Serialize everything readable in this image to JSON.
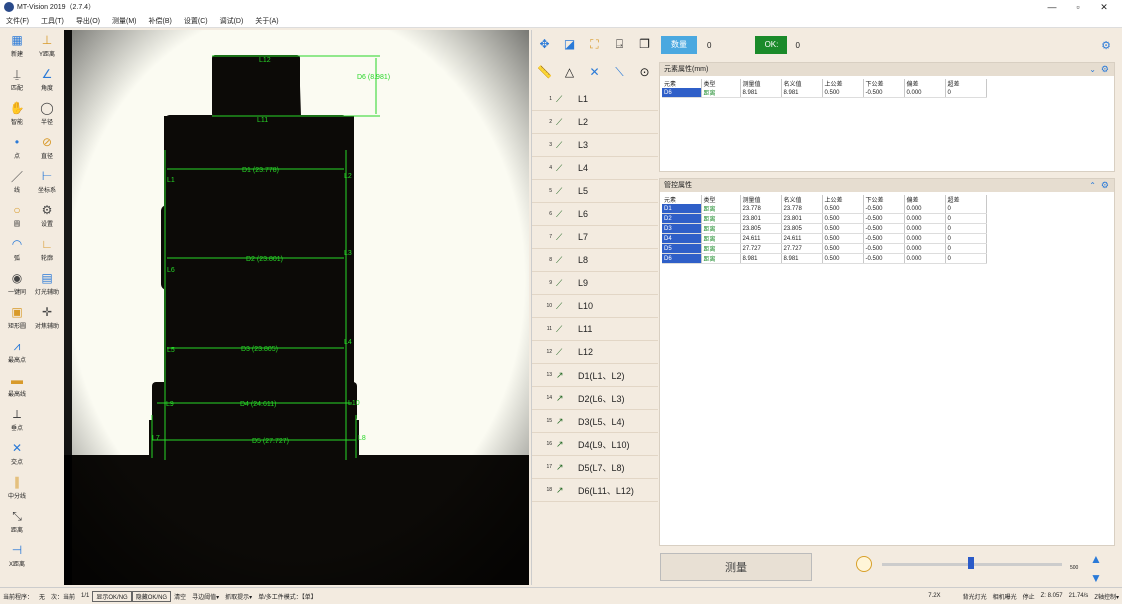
{
  "window": {
    "title": "MT-Vision 2019（2.7.4）"
  },
  "menu": [
    "文件(F)",
    "工具(T)",
    "导出(O)",
    "测量(M)",
    "补偿(B)",
    "设置(C)",
    "调试(D)",
    "关于(A)"
  ],
  "left_tools": [
    {
      "label": "新建",
      "icon": "new-icon"
    },
    {
      "label": "Y距离",
      "icon": "y-distance-icon"
    },
    {
      "label": "匹配",
      "icon": "match-icon"
    },
    {
      "label": "角度",
      "icon": "angle-icon"
    },
    {
      "label": "智能",
      "icon": "smart-icon"
    },
    {
      "label": "半径",
      "icon": "radius-icon"
    },
    {
      "label": "点",
      "icon": "point-icon"
    },
    {
      "label": "直径",
      "icon": "diameter-icon"
    },
    {
      "label": "线",
      "icon": "line-icon"
    },
    {
      "label": "坐标系",
      "icon": "coordinate-icon"
    },
    {
      "label": "圆",
      "icon": "circle-icon"
    },
    {
      "label": "设置",
      "icon": "settings-icon"
    },
    {
      "label": "弧",
      "icon": "arc-icon"
    },
    {
      "label": "轮廓",
      "icon": "contour-icon"
    },
    {
      "label": "一键同",
      "icon": "one-key-icon"
    },
    {
      "label": "灯光辅助",
      "icon": "light-assist-icon"
    },
    {
      "label": "矩形圆",
      "icon": "rect-circle-icon"
    },
    {
      "label": "对焦辅助",
      "icon": "focus-assist-icon"
    },
    {
      "label": "最高点",
      "icon": "highest-point-icon"
    },
    {
      "label": "最高线",
      "icon": "highest-line-icon"
    },
    {
      "label": "垂点",
      "icon": "perpendicular-icon"
    },
    {
      "label": "交点",
      "icon": "intersection-icon"
    },
    {
      "label": "中分线",
      "icon": "midline-icon"
    },
    {
      "label": "距离",
      "icon": "distance-icon"
    },
    {
      "label": "X距离",
      "icon": "x-distance-icon"
    }
  ],
  "canvas": {
    "labels": [
      "L12",
      "L11",
      "D6 (8.981)",
      "D1 (23.778)",
      "D2 (23.801)",
      "D3 (23.805)",
      "D4 (24.611)",
      "D5 (27.727)",
      "L1",
      "L2",
      "L6",
      "L3",
      "L5",
      "L4",
      "L9",
      "L10",
      "L7",
      "L8"
    ]
  },
  "elements": [
    {
      "num": "1",
      "name": "L1"
    },
    {
      "num": "2",
      "name": "L2"
    },
    {
      "num": "3",
      "name": "L3"
    },
    {
      "num": "4",
      "name": "L4"
    },
    {
      "num": "5",
      "name": "L5"
    },
    {
      "num": "6",
      "name": "L6"
    },
    {
      "num": "7",
      "name": "L7"
    },
    {
      "num": "8",
      "name": "L8"
    },
    {
      "num": "9",
      "name": "L9"
    },
    {
      "num": "10",
      "name": "L10"
    },
    {
      "num": "11",
      "name": "L11"
    },
    {
      "num": "12",
      "name": "L12"
    },
    {
      "num": "13",
      "name": "D1(L1、L2)"
    },
    {
      "num": "14",
      "name": "D2(L6、L3)"
    },
    {
      "num": "15",
      "name": "D3(L5、L4)"
    },
    {
      "num": "16",
      "name": "D4(L9、L10)"
    },
    {
      "num": "17",
      "name": "D5(L7、L8)"
    },
    {
      "num": "18",
      "name": "D6(L11、L12)"
    }
  ],
  "counters": {
    "count_label": "数量",
    "count_value": "0",
    "ok_label": "OK:",
    "ok_value": "0"
  },
  "element_props": {
    "title": "元素属性(mm)",
    "headers": [
      "元素",
      "类型",
      "测量值",
      "名义值",
      "上公差",
      "下公差",
      "偏差",
      "超差"
    ],
    "rows": [
      [
        "D6",
        "距离",
        "8.981",
        "8.981",
        "0.500",
        "-0.500",
        "0.000",
        "0"
      ]
    ]
  },
  "manage_props": {
    "title": "管控属性",
    "headers": [
      "元素",
      "类型",
      "测量值",
      "名义值",
      "上公差",
      "下公差",
      "偏差",
      "超差"
    ],
    "rows": [
      [
        "D1",
        "距离",
        "23.778",
        "23.778",
        "0.500",
        "-0.500",
        "0.000",
        "0"
      ],
      [
        "D2",
        "距离",
        "23.801",
        "23.801",
        "0.500",
        "-0.500",
        "0.000",
        "0"
      ],
      [
        "D3",
        "距离",
        "23.805",
        "23.805",
        "0.500",
        "-0.500",
        "0.000",
        "0"
      ],
      [
        "D4",
        "距离",
        "24.611",
        "24.611",
        "0.500",
        "-0.500",
        "0.000",
        "0"
      ],
      [
        "D5",
        "距离",
        "27.727",
        "27.727",
        "0.500",
        "-0.500",
        "0.000",
        "0"
      ],
      [
        "D6",
        "距离",
        "8.981",
        "8.981",
        "0.500",
        "-0.500",
        "0.000",
        "0"
      ]
    ]
  },
  "measure_button": "测量",
  "slider": {
    "max_label": "500",
    "value_fraction": 0.2
  },
  "status": {
    "current_program": "当前程序：",
    "program_value": "无",
    "count": "次：当前",
    "page": "1/1",
    "show_okng": "显示OK/NG",
    "hide_okng": "隐藏OK/NG",
    "clear": "清空",
    "find_edge": "寻边阈值▾",
    "capture": "抓取提示▾",
    "mode": "单/多工件模式：【单】",
    "zoom": "7.2X",
    "light": "背光灯光",
    "camera": "相机曝光",
    "stop": "停止",
    "z_label": "Z: 8.057",
    "fps": "21.74/s",
    "ctrl": "Z轴控制▾"
  },
  "colors": {
    "ok_green": "#1a8a2a",
    "count_blue": "#4aa8e0",
    "overlay": "#27d627",
    "selection": "#2f5fc8"
  }
}
